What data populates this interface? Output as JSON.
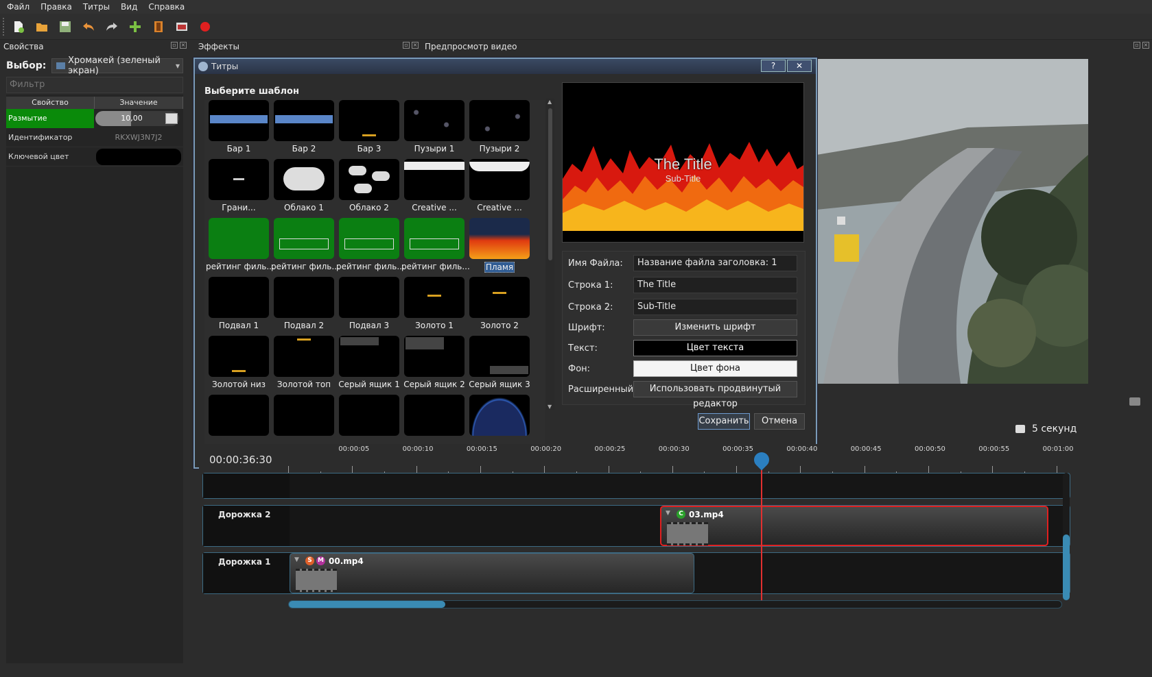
{
  "menu": [
    "Файл",
    "Правка",
    "Титры",
    "Вид",
    "Справка"
  ],
  "toolbar_icons": [
    "new-project-icon",
    "open-project-icon",
    "save-project-icon",
    "undo-icon",
    "redo-icon",
    "add-file-icon",
    "profile-icon",
    "export-video-icon",
    "record-icon"
  ],
  "properties": {
    "title": "Свойства",
    "select_label": "Выбор:",
    "selected_effect": "Хромакей (зеленый экран)",
    "filter_placeholder": "Фильтр",
    "col_property": "Свойство",
    "col_value": "Значение",
    "rows": [
      {
        "name": "Размытие",
        "value": "10,00"
      },
      {
        "name": "Идентификатор",
        "value": "RKXWJ3N7J2"
      },
      {
        "name": "Ключевой цвет",
        "value": ""
      }
    ]
  },
  "effects_title": "Эффекты",
  "preview_title": "Предпросмотр видео",
  "dialog": {
    "title": "Титры",
    "help": "?",
    "close": "✕",
    "choose_label": "Выберите шаблон",
    "templates": [
      "Бар 1",
      "Бар 2",
      "Бар 3",
      "Пузыри 1",
      "Пузыри 2",
      "Грани...",
      "Облако 1",
      "Облако 2",
      "Creative ...",
      "Creative ...",
      "рейтинг филь...",
      "рейтинг филь...",
      "рейтинг филь...",
      "рейтинг филь...",
      "Пламя",
      "Подвал 1",
      "Подвал 2",
      "Подвал 3",
      "Золото 1",
      "Золото 2",
      "Золотой низ",
      "Золотой топ",
      "Серый ящик 1",
      "Серый ящик 2",
      "Серый ящик 3"
    ],
    "selected_template": "Пламя",
    "preview_title": "The Title",
    "preview_subtitle": "Sub-Title",
    "form": {
      "file_label": "Имя Файла:",
      "file_value": "Название файла заголовка: 1",
      "line1_label": "Строка 1:",
      "line1_value": "The Title",
      "line2_label": "Строка 2:",
      "line2_value": "Sub-Title",
      "font_label": "Шрифт:",
      "font_button": "Изменить шрифт",
      "text_label": "Текст:",
      "text_button": "Цвет текста",
      "bg_label": "Фон:",
      "bg_button": "Цвет фона",
      "advanced_label": "Расширенный:",
      "advanced_button": "Использовать продвинутый редактор"
    },
    "save": "Сохранить",
    "cancel": "Отмена"
  },
  "timeline": {
    "timecode": "00:00:36:30",
    "seconds_label": "5 секунд",
    "ruler": [
      "00:00:05",
      "00:00:10",
      "00:00:15",
      "00:00:20",
      "00:00:25",
      "00:00:30",
      "00:00:35",
      "00:00:40",
      "00:00:45",
      "00:00:50",
      "00:00:55",
      "00:01:00"
    ],
    "tracks": [
      {
        "name": ""
      },
      {
        "name": "Дорожка 2"
      },
      {
        "name": "Дорожка 1"
      }
    ],
    "clips": [
      {
        "name": "03.mp4",
        "badges": [
          "C"
        ]
      },
      {
        "name": "00.mp4",
        "badges": [
          "S",
          "M"
        ]
      }
    ]
  }
}
